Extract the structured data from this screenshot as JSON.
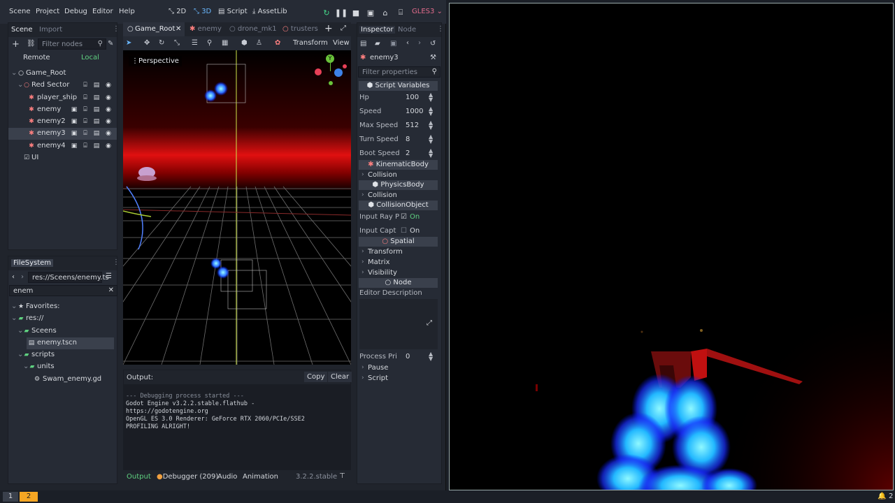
{
  "menubar": {
    "menus": [
      "Scene",
      "Project",
      "Debug",
      "Editor",
      "Help"
    ],
    "modes": [
      {
        "label": "2D",
        "icon": "2d-icon"
      },
      {
        "label": "3D",
        "icon": "3d-icon"
      },
      {
        "label": "Script",
        "icon": "script-icon"
      },
      {
        "label": "AssetLib",
        "icon": "assetlib-icon"
      }
    ],
    "renderer": "GLES3"
  },
  "scene_dock": {
    "tabs": [
      "Scene",
      "Import"
    ],
    "filter_placeholder": "Filter nodes",
    "remote_label": "Remote",
    "local_label": "Local",
    "tree": [
      {
        "label": "Game_Root",
        "icon": "spatial-icon",
        "depth": 0
      },
      {
        "label": "Red Sector",
        "icon": "spatial-icon",
        "depth": 1
      },
      {
        "label": "player_ship",
        "icon": "kinematic-icon",
        "depth": 2
      },
      {
        "label": "enemy",
        "icon": "kinematic-icon",
        "depth": 2
      },
      {
        "label": "enemy2",
        "icon": "kinematic-icon",
        "depth": 2
      },
      {
        "label": "enemy3",
        "icon": "kinematic-icon",
        "depth": 2
      },
      {
        "label": "enemy4",
        "icon": "kinematic-icon",
        "depth": 2
      },
      {
        "label": "UI",
        "icon": "control-icon",
        "depth": 1
      }
    ]
  },
  "filesystem_dock": {
    "title": "FileSystem",
    "path": "res://Sceens/enemy.ts",
    "search": "enem",
    "tree": [
      {
        "label": "Favorites:",
        "icon": "star-icon"
      },
      {
        "label": "res://",
        "icon": "folder-icon"
      },
      {
        "label": "Sceens",
        "icon": "folder-icon"
      },
      {
        "label": "enemy.tscn",
        "icon": "scene-file-icon"
      },
      {
        "label": "scripts",
        "icon": "folder-icon"
      },
      {
        "label": "units",
        "icon": "folder-icon"
      },
      {
        "label": "Swam_enemy.gd",
        "icon": "gear-icon"
      }
    ]
  },
  "editor_tabs": [
    "Game_Root",
    "enemy",
    "drone_mk1",
    "trusters"
  ],
  "viewport": {
    "perspective_label": "Perspective",
    "transform_label": "Transform",
    "view_label": "View",
    "gizmo": {
      "x": "X",
      "y": "Y",
      "z": "Z"
    }
  },
  "output": {
    "title": "Output:",
    "copy": "Copy",
    "clear": "Clear",
    "lines": [
      "--- Debugging process started ---",
      "Godot Engine v3.2.2.stable.flathub -",
      "https://godotengine.org",
      "OpenGL ES 3.0 Renderer: GeForce RTX 2060/PCIe/SSE2",
      "",
      "PROFILING ALRIGHT!"
    ],
    "bottom_tabs": [
      "Output",
      "Debugger (209)",
      "Audio",
      "Animation"
    ],
    "version": "3.2.2.stable"
  },
  "inspector": {
    "tabs": [
      "Inspector",
      "Node"
    ],
    "node_name": "enemy3",
    "filter_placeholder": "Filter properties",
    "script_variables_label": "Script Variables",
    "props": [
      {
        "label": "Hp",
        "value": "100"
      },
      {
        "label": "Speed",
        "value": "1000"
      },
      {
        "label": "Max Speed",
        "value": "512"
      },
      {
        "label": "Turn Speed",
        "value": "8"
      },
      {
        "label": "Boot Speed",
        "value": "2"
      }
    ],
    "kinematic_label": "KinematicBody",
    "collision_label": "Collision",
    "physics_label": "PhysicsBody",
    "collision2_label": "Collision",
    "collisionobject_label": "CollisionObject",
    "input_ray_label": "Input Ray P",
    "input_ray_value": "On",
    "input_capt_label": "Input Capt",
    "input_capt_value": "On",
    "spatial_label": "Spatial",
    "transform_label": "Transform",
    "matrix_label": "Matrix",
    "visibility_label": "Visibility",
    "node_label": "Node",
    "editor_desc_label": "Editor Description",
    "process_pri_label": "Process Pri",
    "process_pri_value": "0",
    "pause_label": "Pause",
    "script_label": "Script"
  },
  "taskbar": {
    "workspaces": [
      "1",
      "2"
    ],
    "notif_count": "2"
  },
  "colors": {
    "accent": "#6ab8ff",
    "node_red": "#fc7f7f",
    "folder_green": "#5fd180",
    "renderer_red": "#e36b8c",
    "play_green": "#45d98b"
  }
}
